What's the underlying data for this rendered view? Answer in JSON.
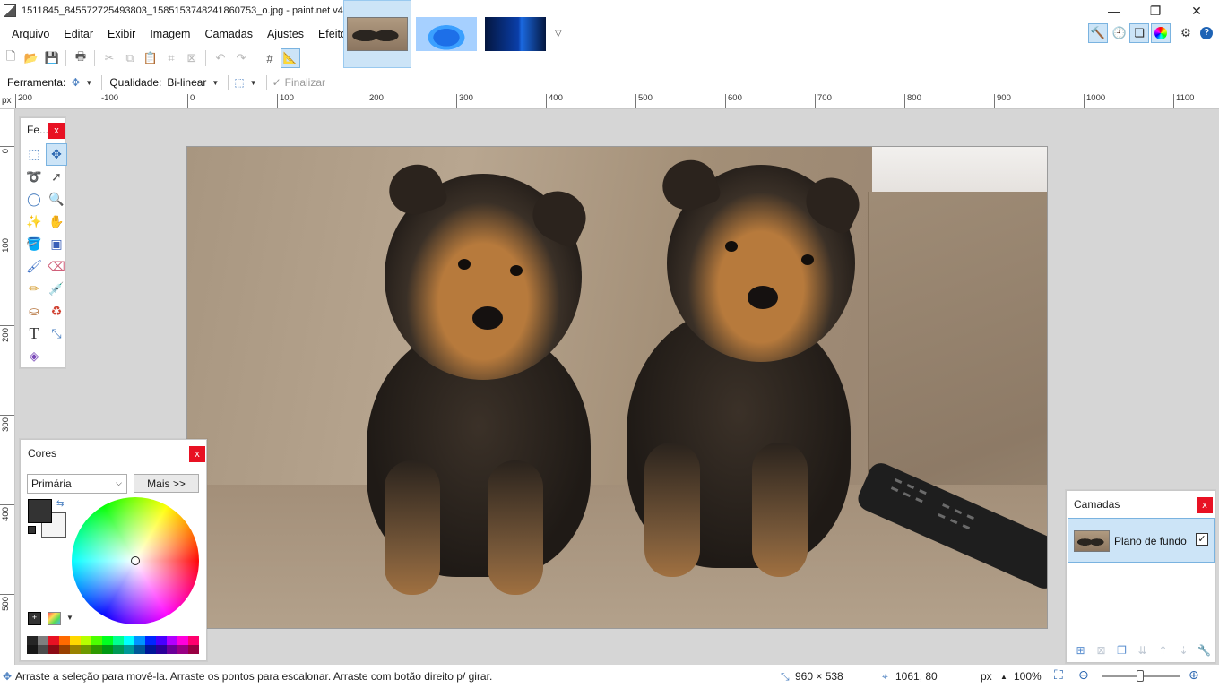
{
  "window": {
    "title": "1511845_845572725493803_1585153748241860753_o.jpg - paint.net v4.3",
    "controls": {
      "minimize": "—",
      "maximize": "❐",
      "close": "✕"
    }
  },
  "menu": [
    "Arquivo",
    "Editar",
    "Exibir",
    "Imagem",
    "Camadas",
    "Ajustes",
    "Efeitos"
  ],
  "image_tabs": [
    {
      "name": "puppies",
      "active": true
    },
    {
      "name": "windows-11-wallpaper",
      "active": false
    },
    {
      "name": "windows-10-wallpaper",
      "active": false
    }
  ],
  "options_bar": {
    "tool_label": "Ferramenta:",
    "quality_label": "Qualidade:",
    "quality_value": "Bi-linear",
    "finish_label": "Finalizar"
  },
  "rulers": {
    "unit": "px",
    "horizontal": [
      "200",
      "-100",
      "0",
      "100",
      "200",
      "300",
      "400",
      "500",
      "600",
      "700",
      "800",
      "900",
      "1000",
      "1100"
    ],
    "vertical": [
      "0",
      "100",
      "200",
      "300",
      "400",
      "500"
    ]
  },
  "tools_panel": {
    "title": "Fe..."
  },
  "colors_panel": {
    "title": "Cores",
    "select_value": "Primária",
    "more_button": "Mais >>",
    "primary_color": "#333333",
    "secondary_color": "#f5f5f5",
    "palette": [
      "#262626",
      "#7f7f7f",
      "#e81123",
      "#ff6a00",
      "#ffd800",
      "#b6ff00",
      "#4cff00",
      "#00ff21",
      "#00ff90",
      "#00ffff",
      "#0094ff",
      "#0026ff",
      "#4800ff",
      "#b200ff",
      "#ff00dc",
      "#ff006e"
    ]
  },
  "layers_panel": {
    "title": "Camadas",
    "layers": [
      {
        "name": "Plano de fundo",
        "visible": true
      }
    ]
  },
  "status": {
    "hint": "Arraste a seleção para movê-la. Arraste os pontos para escalonar. Arraste com botão direito p/ girar.",
    "image_size": "960 × 538",
    "cursor_position": "1061, 80",
    "unit": "px",
    "zoom": "100%"
  }
}
